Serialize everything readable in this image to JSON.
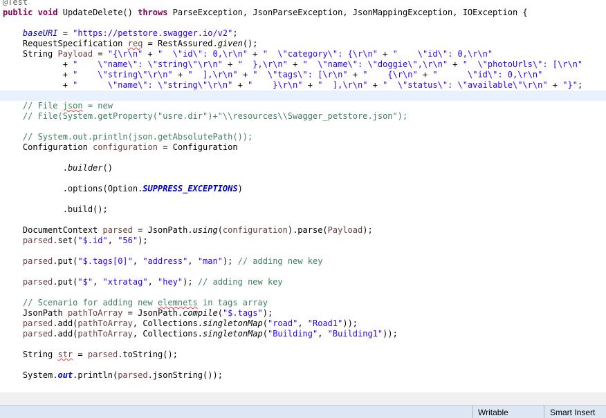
{
  "code": {
    "l1": {
      "ann": "@Test"
    },
    "l2": {
      "kw1": "public",
      "kw2": "void",
      "name": " UpdateDelete() ",
      "kw3": "throws",
      "rest": " ParseException, JsonParseException, JsonMappingException, IOException {"
    },
    "l3": {
      "fld": "baseURI",
      "op": " = ",
      "str": "\"https://petstore.swagger.io/v2\"",
      "end": ";"
    },
    "l4": {
      "type": "RequestSpecification ",
      "var": "req",
      "mid": " = RestAssured.",
      "meth": "given",
      "end": "();"
    },
    "l5": {
      "type": "String ",
      "var": "Payload",
      "op": " = ",
      "s1": "\"{\\r\\n\"",
      "p1": " + ",
      "s2": "\"  \\\"id\\\": 0,\\r\\n\"",
      "p2": " + ",
      "s3": "\"  \\\"category\\\": {\\r\\n\"",
      "p3": " + ",
      "s4": "\"    \\\"id\\\": 0,\\r\\n\""
    },
    "l6": {
      "p0": "+ ",
      "s1": "\"    \\\"name\\\": \\\"string\\\"\\r\\n\"",
      "p1": " + ",
      "s2": "\"  },\\r\\n\"",
      "p2": " + ",
      "s3": "\"  \\\"name\\\": \\\"doggie\\\",\\r\\n\"",
      "p3": " + ",
      "s4": "\"  \\\"photoUrls\\\": [\\r\\n\""
    },
    "l7": {
      "p0": "+ ",
      "s1": "\"    \\\"string\\\"\\r\\n\"",
      "p1": " + ",
      "s2": "\"  ],\\r\\n\"",
      "p2": " + ",
      "s3": "\"  \\\"tags\\\": [\\r\\n\"",
      "p3": " + ",
      "s4": "\"    {\\r\\n\"",
      "p4": " + ",
      "s5": "\"      \\\"id\\\": 0,\\r\\n\""
    },
    "l8": {
      "p0": "+ ",
      "s1": "\"      \\\"name\\\": \\\"string\\\"\\r\\n\"",
      "p1": " + ",
      "s2": "\"    }\\r\\n\"",
      "p2": " + ",
      "s3": "\"  ],\\r\\n\"",
      "p3": " + ",
      "s4": "\"  \\\"status\\\": \\\"available\\\"\\r\\n\"",
      "p4": " + ",
      "s5": "\"}\"",
      "end": ";"
    },
    "l9": {
      "a": "// File ",
      "sq": "json",
      "b": " = new"
    },
    "l10": {
      "cmt": "// File(System.getProperty(\"usre.dir\")+\"\\\\resources\\\\Swagger_petstore.json\");"
    },
    "l11": {
      "cmt": "// System.out.println(json.getAbsolutePath());"
    },
    "l12": {
      "type": "Configuration ",
      "var": "configuration",
      "rest": " = Configuration"
    },
    "l13": {
      "dot": ".",
      "meth": "builder",
      "end": "()"
    },
    "l14": {
      "dot": ".options(Option.",
      "const": "SUPPRESS_EXCEPTIONS",
      "end": ")"
    },
    "l15": {
      "txt": ".build();"
    },
    "l16": {
      "type": "DocumentContext ",
      "var": "parsed",
      "mid": " = JsonPath.",
      "meth": "using",
      "o": "(",
      "arg": "configuration",
      "m2": ").parse(",
      "arg2": "Payload",
      "end": ");"
    },
    "l17": {
      "var": "parsed",
      "m": ".set(",
      "s1": "\"$.id\"",
      "c": ", ",
      "s2": "\"56\"",
      "end": ");"
    },
    "l18": {
      "var": "parsed",
      "m": ".put(",
      "s1": "\"$.tags[0]\"",
      "c1": ", ",
      "s2": "\"address\"",
      "c2": ", ",
      "s3": "\"man\"",
      "end": "); ",
      "cmt": "// adding new key"
    },
    "l19": {
      "var": "parsed",
      "m": ".put(",
      "s1": "\"$\"",
      "c1": ", ",
      "s2": "\"xtratag\"",
      "c2": ", ",
      "s3": "\"hey\"",
      "end": "); ",
      "cmt": "// adding new key"
    },
    "l20": {
      "a": "// Scenario for adding new ",
      "sq": "elemnets",
      "b": " in tags array"
    },
    "l21": {
      "type": "JsonPath ",
      "var": "pathToArray",
      "mid": " = JsonPath.",
      "meth": "compile",
      "o": "(",
      "s": "\"$.tags\"",
      "end": ");"
    },
    "l22": {
      "var": "parsed",
      "m": ".add(",
      "v2": "pathToArray",
      "c": ", Collections.",
      "meth": "singletonMap",
      "o": "(",
      "s1": "\"road\"",
      "c2": ", ",
      "s2": "\"Road1\"",
      "end": "));"
    },
    "l23": {
      "var": "parsed",
      "m": ".add(",
      "v2": "pathToArray",
      "c": ", Collections.",
      "meth": "singletonMap",
      "o": "(",
      "s1": "\"Building\"",
      "c2": ", ",
      "s2": "\"Building1\"",
      "end": "));"
    },
    "l24": {
      "type": "String ",
      "var": "str",
      "mid": " = ",
      "v2": "parsed",
      "end": ".toString();"
    },
    "l25": {
      "a": "System.",
      "fld": "out",
      "b": ".println(",
      "v": "parsed",
      "end": ".jsonString());"
    }
  },
  "statusbar": {
    "writable": "Writable",
    "insert_mode": "Smart Insert"
  }
}
